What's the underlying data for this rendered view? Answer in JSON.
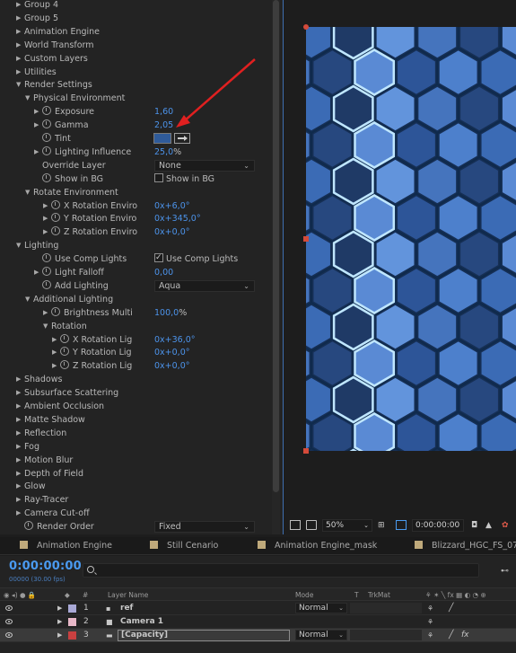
{
  "effect_controls": {
    "rows": [
      {
        "indent": 0,
        "twirl": "closed",
        "label": "Group 4"
      },
      {
        "indent": 0,
        "twirl": "closed",
        "label": "Group 5"
      },
      {
        "indent": 0,
        "twirl": "closed",
        "label": "Animation Engine"
      },
      {
        "indent": 0,
        "twirl": "closed",
        "label": "World Transform"
      },
      {
        "indent": 0,
        "twirl": "closed",
        "label": "Custom Layers"
      },
      {
        "indent": 0,
        "twirl": "closed",
        "label": "Utilities"
      },
      {
        "indent": 0,
        "twirl": "open",
        "label": "Render Settings"
      },
      {
        "indent": 1,
        "twirl": "open",
        "label": "Physical Environment"
      },
      {
        "indent": 2,
        "twirl": "closed",
        "stopwatch": true,
        "label": "Exposure",
        "value": "1,60"
      },
      {
        "indent": 2,
        "twirl": "closed",
        "stopwatch": true,
        "label": "Gamma",
        "value": "2,05"
      },
      {
        "indent": 2,
        "stopwatch": true,
        "label": "Tint",
        "color": "#2f5b9a"
      },
      {
        "indent": 2,
        "twirl": "closed",
        "stopwatch": true,
        "label": "Lighting Influence",
        "value": "25,0",
        "unit": "%"
      },
      {
        "indent": 2,
        "label": "Override Layer",
        "dropdown": "None"
      },
      {
        "indent": 2,
        "stopwatch": true,
        "label": "Show in BG",
        "checkbox": "Show in BG",
        "checked": false
      },
      {
        "indent": 1,
        "twirl": "open",
        "label": "Rotate Environment"
      },
      {
        "indent": 3,
        "twirl": "closed",
        "stopwatch": true,
        "label": "X Rotation Enviro",
        "value": "0x+6,0°"
      },
      {
        "indent": 3,
        "twirl": "closed",
        "stopwatch": true,
        "label": "Y Rotation Enviro",
        "value": "0x+345,0°"
      },
      {
        "indent": 3,
        "twirl": "closed",
        "stopwatch": true,
        "label": "Z Rotation Enviro",
        "value": "0x+0,0°"
      },
      {
        "indent": 0,
        "twirl": "open",
        "label": "Lighting"
      },
      {
        "indent": 2,
        "stopwatch": true,
        "label": "Use Comp Lights",
        "checkbox": "Use Comp Lights",
        "checked": true
      },
      {
        "indent": 2,
        "twirl": "closed",
        "stopwatch": true,
        "label": "Light Falloff",
        "value": "0,00"
      },
      {
        "indent": 2,
        "stopwatch": true,
        "label": "Add Lighting",
        "dropdown": "Aqua"
      },
      {
        "indent": 1,
        "twirl": "open",
        "label": "Additional Lighting"
      },
      {
        "indent": 3,
        "twirl": "closed",
        "stopwatch": true,
        "label": "Brightness Multi",
        "value": "100,0",
        "unit": "%"
      },
      {
        "indent": 3,
        "twirl": "open",
        "label": "Rotation"
      },
      {
        "indent": 4,
        "twirl": "closed",
        "stopwatch": true,
        "label": "X Rotation Lig",
        "value": "0x+36,0°"
      },
      {
        "indent": 4,
        "twirl": "closed",
        "stopwatch": true,
        "label": "Y Rotation Lig",
        "value": "0x+0,0°"
      },
      {
        "indent": 4,
        "twirl": "closed",
        "stopwatch": true,
        "label": "Z Rotation Lig",
        "value": "0x+0,0°"
      },
      {
        "indent": 0,
        "twirl": "closed",
        "label": "Shadows"
      },
      {
        "indent": 0,
        "twirl": "closed",
        "label": "Subsurface Scattering"
      },
      {
        "indent": 0,
        "twirl": "closed",
        "label": "Ambient Occlusion"
      },
      {
        "indent": 0,
        "twirl": "closed",
        "label": "Matte Shadow"
      },
      {
        "indent": 0,
        "twirl": "closed",
        "label": "Reflection"
      },
      {
        "indent": 0,
        "twirl": "closed",
        "label": "Fog"
      },
      {
        "indent": 0,
        "twirl": "closed",
        "label": "Motion Blur"
      },
      {
        "indent": 0,
        "twirl": "closed",
        "label": "Depth of Field"
      },
      {
        "indent": 0,
        "twirl": "closed",
        "label": "Glow"
      },
      {
        "indent": 0,
        "twirl": "closed",
        "label": "Ray-Tracer"
      },
      {
        "indent": 0,
        "twirl": "closed",
        "label": "Camera Cut-off"
      },
      {
        "indent": 0,
        "stopwatch": true,
        "label": "Render Order",
        "dropdown": "Fixed"
      }
    ]
  },
  "viewer": {
    "zoom": "50%",
    "timecode": "0:00:00:00"
  },
  "timeline_tabs": [
    {
      "label": "Animation Engine",
      "color": "#bfa97b"
    },
    {
      "label": "Still Cenario",
      "color": "#bfa97b"
    },
    {
      "label": "Animation Engine_mask",
      "color": "#bfa97b"
    },
    {
      "label": "Blizzard_HGC_FS_07",
      "color": "#bfa97b"
    }
  ],
  "timeline": {
    "timecode": "0:00:00:00",
    "fps": "00000 (30.00 fps)",
    "search_placeholder": "",
    "columns": {
      "number": "#",
      "layer_name": "Layer Name",
      "mode": "Mode",
      "t": "T",
      "trkmat": "TrkMat"
    },
    "layers": [
      {
        "num": "1",
        "name": "ref",
        "color": "#a9a9d6",
        "mode": "Normal",
        "type": "solid"
      },
      {
        "num": "2",
        "name": "Camera 1",
        "color": "#e8b8c8",
        "mode": "",
        "type": "camera"
      },
      {
        "num": "3",
        "name": "[Capacity]",
        "color": "#c84040",
        "mode": "Normal",
        "type": "precomp",
        "selected": true
      }
    ]
  }
}
